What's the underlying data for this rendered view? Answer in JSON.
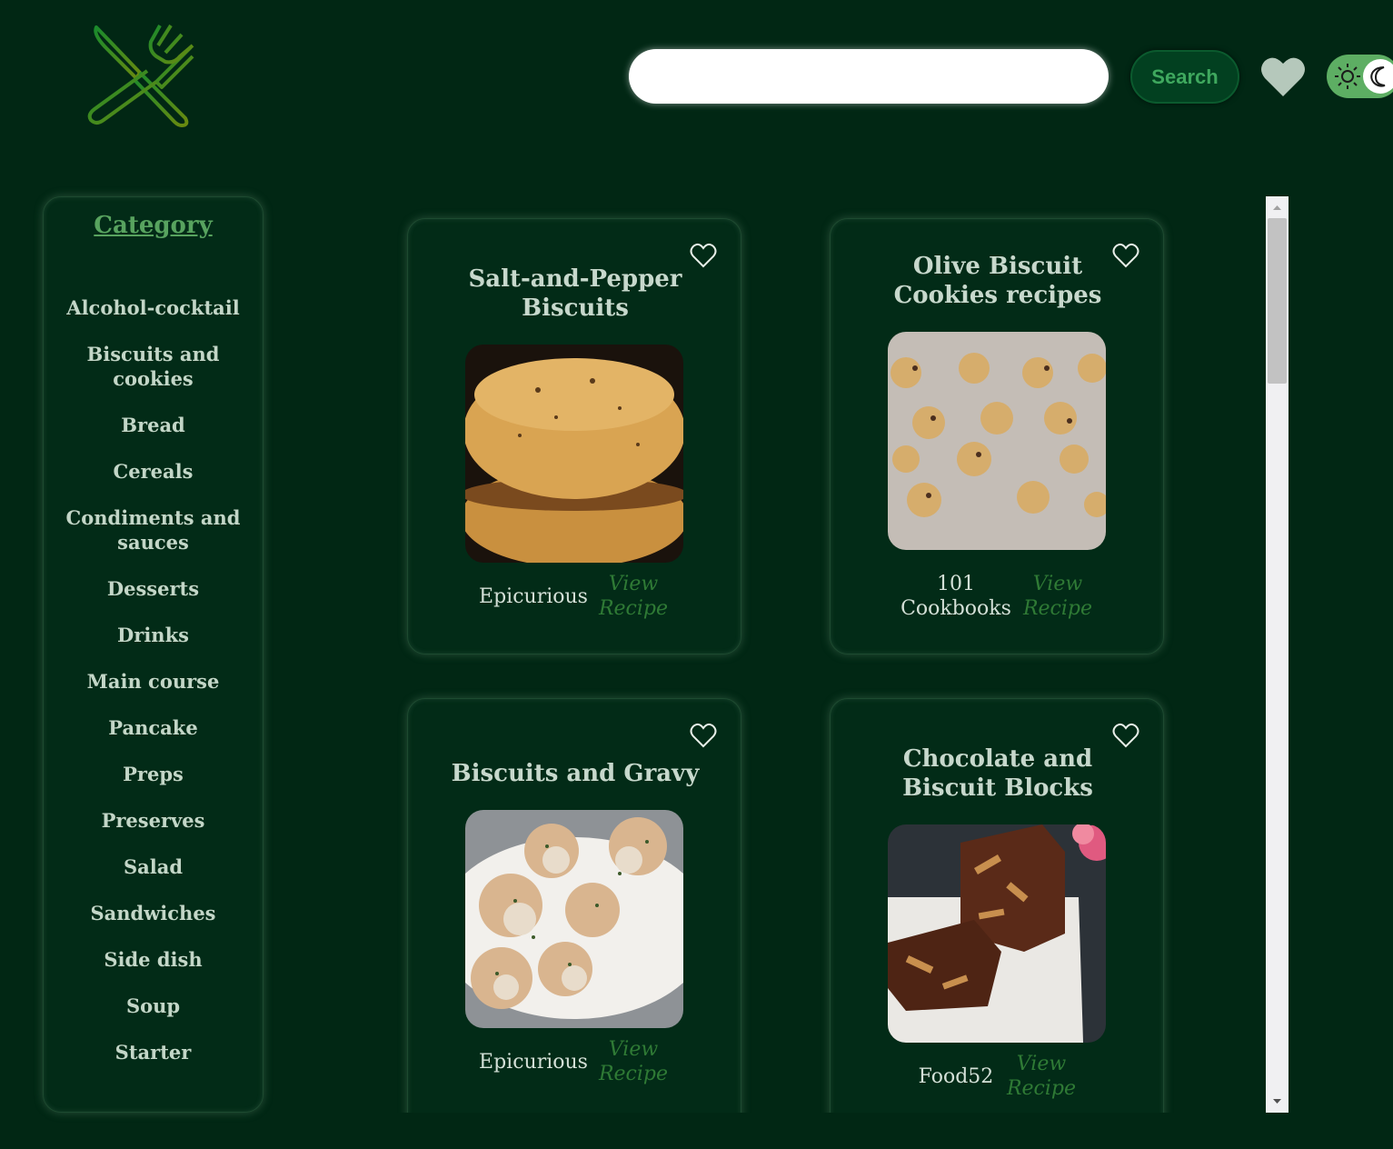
{
  "header": {
    "logo_icon": "fork-knife-icon",
    "search": {
      "placeholder": "",
      "value": ""
    },
    "search_button_label": "Search",
    "favorites_icon": "heart-icon",
    "theme_toggle": {
      "left_icon": "sun-icon",
      "right_icon": "moon-icon",
      "mode": "dark"
    }
  },
  "sidebar": {
    "title": "Category",
    "items": [
      {
        "label": "Alcohol-cocktail"
      },
      {
        "label": "Biscuits and cookies"
      },
      {
        "label": "Bread"
      },
      {
        "label": "Cereals"
      },
      {
        "label": "Condiments and sauces"
      },
      {
        "label": "Desserts"
      },
      {
        "label": "Drinks"
      },
      {
        "label": "Main course"
      },
      {
        "label": "Pancake"
      },
      {
        "label": "Preps"
      },
      {
        "label": "Preserves"
      },
      {
        "label": "Salad"
      },
      {
        "label": "Sandwiches"
      },
      {
        "label": "Side dish"
      },
      {
        "label": "Soup"
      },
      {
        "label": "Starter"
      }
    ]
  },
  "recipes": [
    {
      "title": "Salt-and-Pepper Biscuits",
      "source": "Epicurious",
      "view_label": "View Recipe",
      "favorite_icon": "heart-outline-icon"
    },
    {
      "title": "Olive Biscuit Cookies recipes",
      "source": "101 Cookbooks",
      "view_label": "View Recipe",
      "favorite_icon": "heart-outline-icon"
    },
    {
      "title": "Biscuits and Gravy",
      "source": "Epicurious",
      "view_label": "View Recipe",
      "favorite_icon": "heart-outline-icon"
    },
    {
      "title": "Chocolate and Biscuit Blocks",
      "source": "Food52",
      "view_label": "View Recipe",
      "favorite_icon": "heart-outline-icon"
    }
  ],
  "colors": {
    "background": "#012714",
    "accent": "#58a35f",
    "link": "#2f7a35",
    "text": "#c7d8cc"
  }
}
